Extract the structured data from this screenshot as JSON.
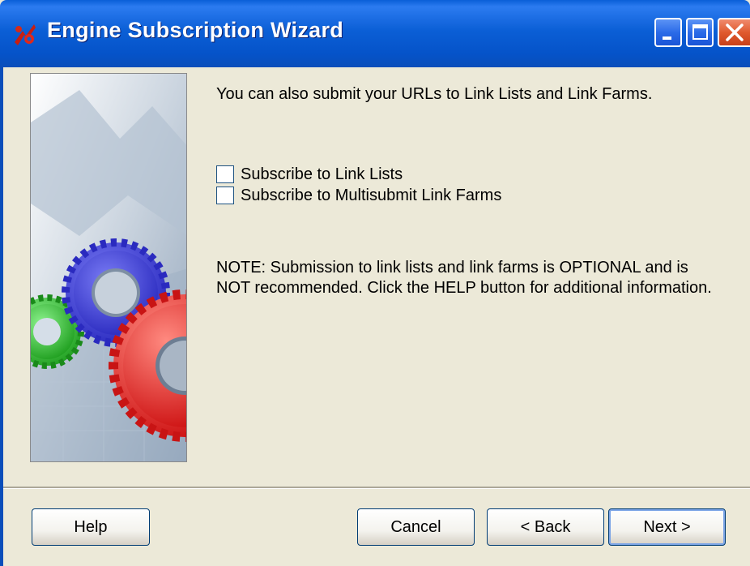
{
  "window": {
    "title": "Engine Subscription Wizard",
    "colors": {
      "titlebar": "#0A5FD8",
      "close_button": "#E05A2E",
      "face": "#ECE9D8"
    },
    "controls": {
      "minimize_icon": "minimize-icon",
      "maximize_icon": "maximize-icon",
      "close_icon": "close-icon"
    },
    "app_icon": "wizard-gears-icon"
  },
  "main": {
    "intro": "You can also submit your URLs to Link Lists and Link Farms.",
    "options": [
      {
        "label": "Subscribe to Link Lists",
        "checked": false
      },
      {
        "label": "Subscribe to Multisubmit Link Farms",
        "checked": false
      }
    ],
    "note_line1": "NOTE: Submission to link lists and link farms is OPTIONAL and is",
    "note_line2": "NOT recommended. Click the HELP button for additional information."
  },
  "buttons": {
    "help": "Help",
    "cancel": "Cancel",
    "back": "< Back",
    "next": "Next >"
  }
}
